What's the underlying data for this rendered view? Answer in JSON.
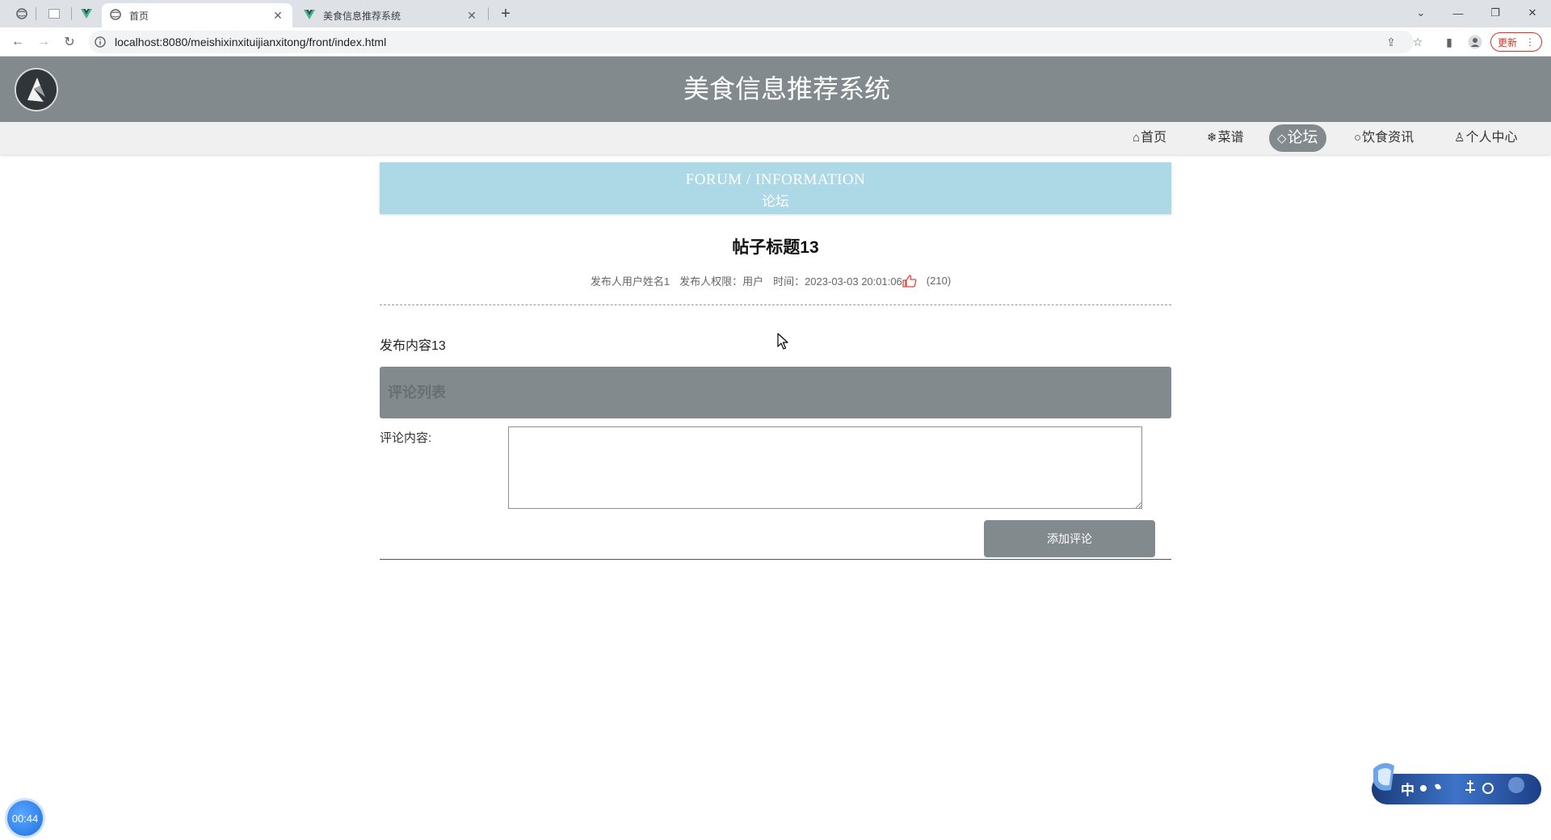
{
  "browser": {
    "tabs": [
      {
        "title": "首页",
        "active": true
      },
      {
        "title": "美食信息推荐系统",
        "active": false
      }
    ],
    "url": "localhost:8080/meishixinxituijianxitong/front/index.html",
    "update_label": "更新"
  },
  "site": {
    "title": "美食信息推荐系统",
    "nav": [
      {
        "glyph": "⌂",
        "label": "首页",
        "active": false
      },
      {
        "glyph": "❄",
        "label": "菜谱",
        "active": false
      },
      {
        "glyph": "◇",
        "label": "论坛",
        "active": true
      },
      {
        "glyph": "○",
        "label": "饮食资讯",
        "active": false
      },
      {
        "glyph": "♙",
        "label": "个人中心",
        "active": false
      }
    ]
  },
  "banner": {
    "en": "FORUM / INFORMATION",
    "cn": "论坛"
  },
  "post": {
    "title": "帖子标题13",
    "author": "发布人用户姓名1",
    "role": "发布人权限：用户",
    "time": "时间：2023-03-03 20:01:06",
    "likes": "(210)",
    "content": "发布内容13"
  },
  "comments": {
    "header": "评论列表",
    "label": "评论内容:",
    "value": "",
    "submit_label": "添加评论"
  },
  "widgets": {
    "timer": "00:44",
    "ime_text": "中"
  },
  "colors": {
    "header_bg": "#838a8d",
    "banner_bg": "#add8e6",
    "like_icon": "#e0463a"
  }
}
